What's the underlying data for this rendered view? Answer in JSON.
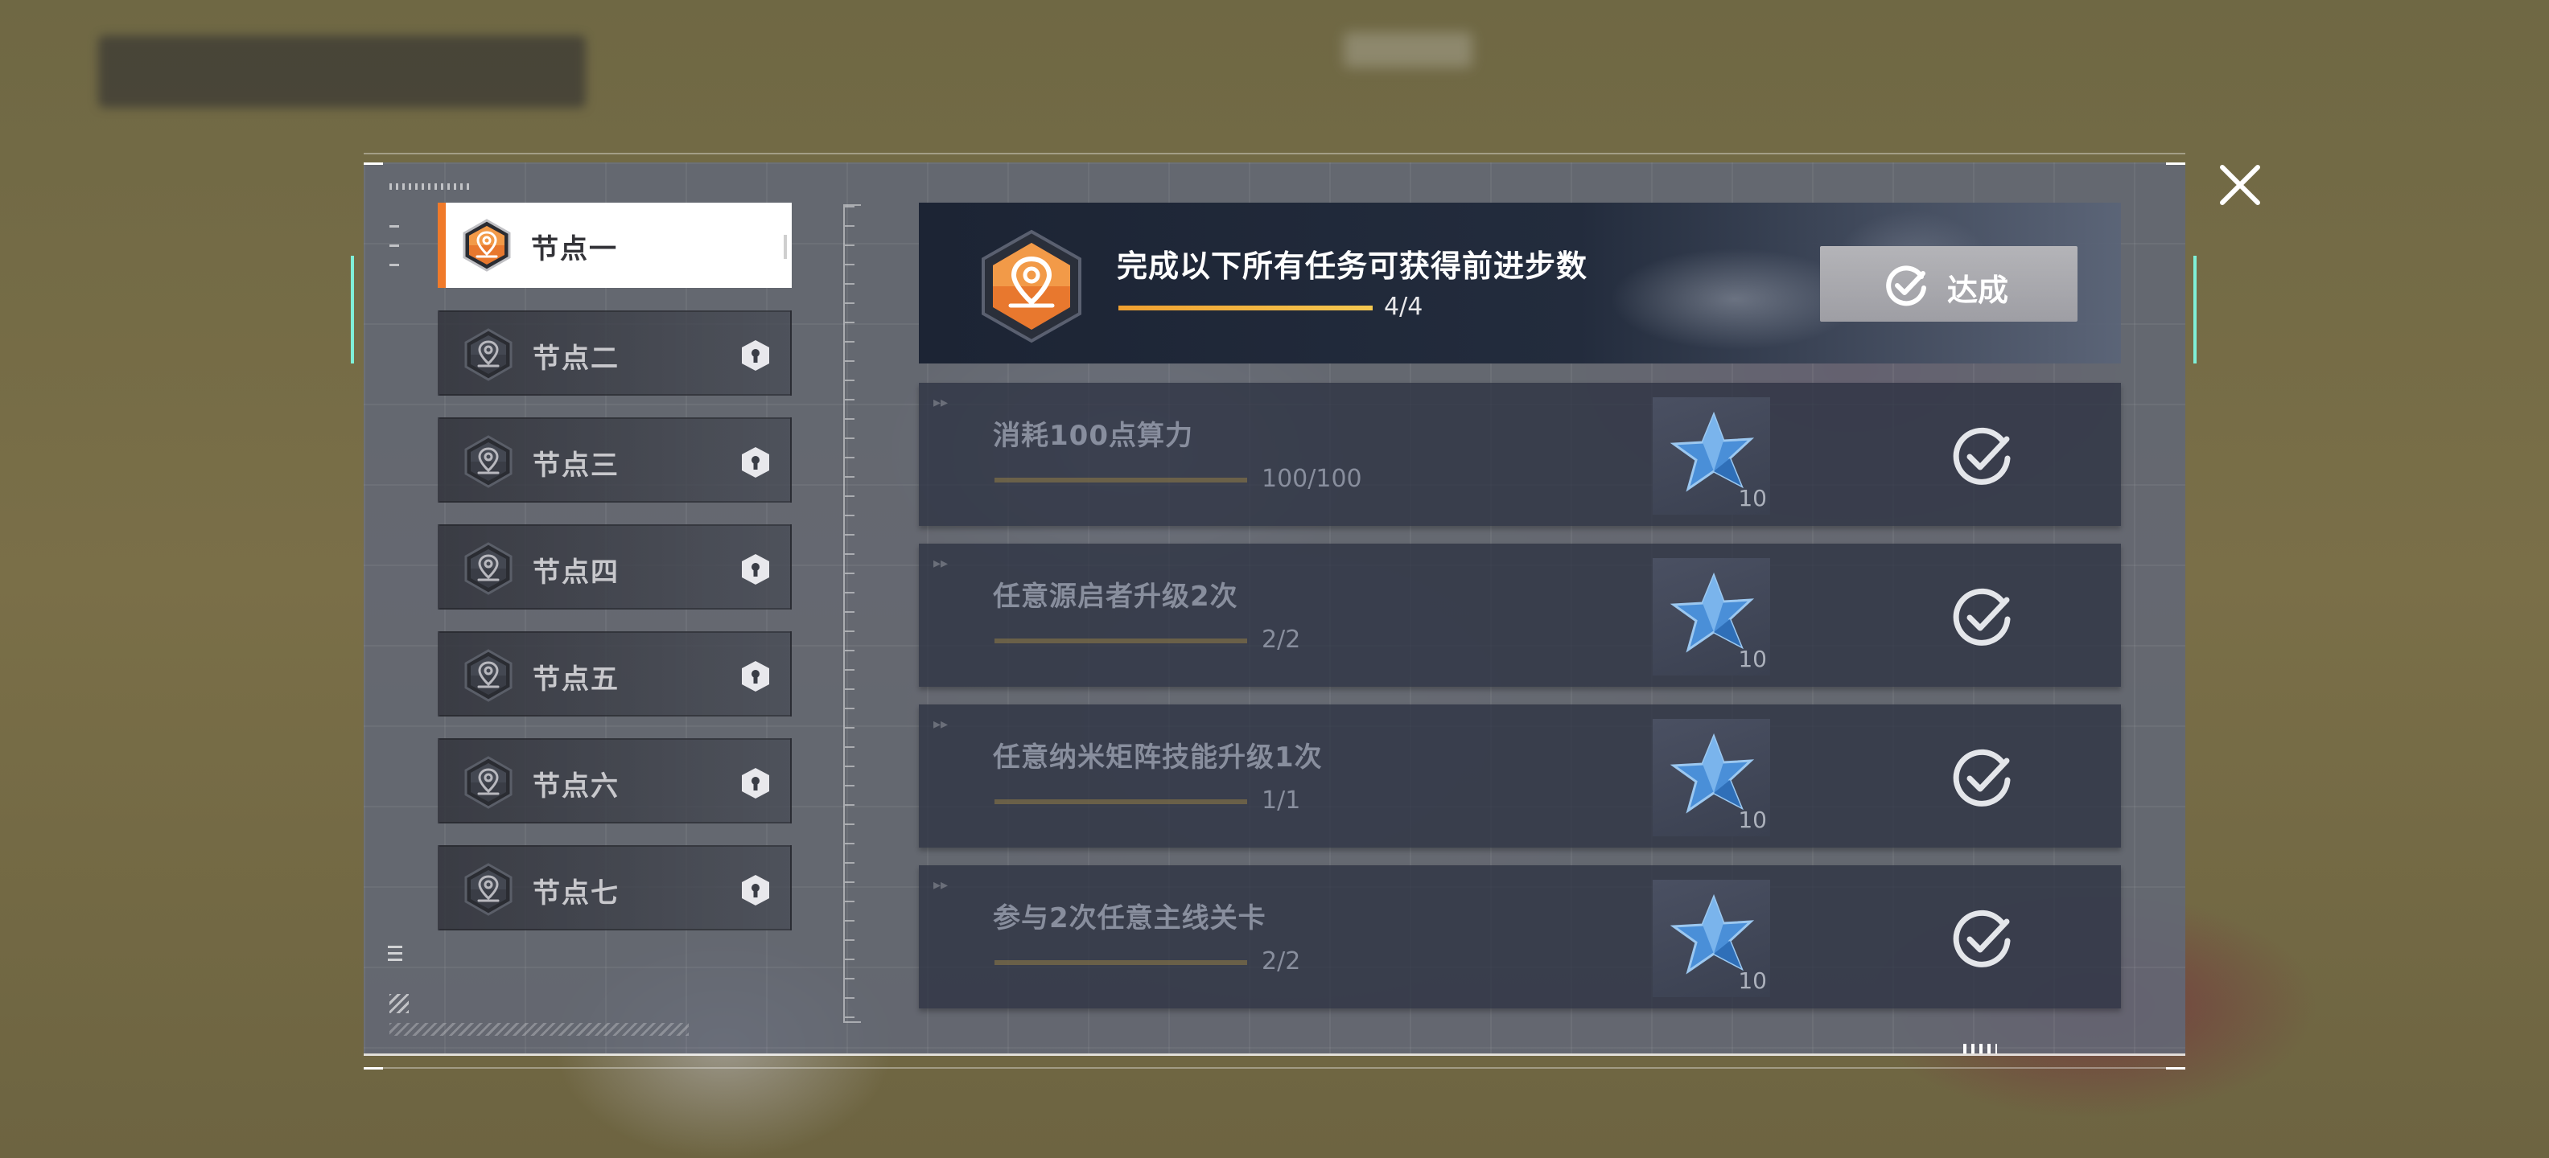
{
  "nodes": [
    {
      "label": "节点一",
      "active": true,
      "locked": false
    },
    {
      "label": "节点二",
      "active": false,
      "locked": true
    },
    {
      "label": "节点三",
      "active": false,
      "locked": true
    },
    {
      "label": "节点四",
      "active": false,
      "locked": true
    },
    {
      "label": "节点五",
      "active": false,
      "locked": true
    },
    {
      "label": "节点六",
      "active": false,
      "locked": true
    },
    {
      "label": "节点七",
      "active": false,
      "locked": true
    }
  ],
  "header": {
    "title": "完成以下所有任务可获得前进步数",
    "progress_text": "4/4",
    "progress": 1.0,
    "button_label": "达成"
  },
  "tasks": [
    {
      "title": "消耗100点算力",
      "count": "100/100",
      "reward_qty": "10",
      "completed": true
    },
    {
      "title": "任意源启者升级2次",
      "count": "2/2",
      "reward_qty": "10",
      "completed": true
    },
    {
      "title": "任意纳米矩阵技能升级1次",
      "count": "1/1",
      "reward_qty": "10",
      "completed": true
    },
    {
      "title": "参与2次任意主线关卡",
      "count": "2/2",
      "reward_qty": "10",
      "completed": true
    }
  ],
  "colors": {
    "accent_orange": "#f07a2a",
    "frame_accent": "#7ff0d8",
    "progress_gold": "#f0b040"
  }
}
